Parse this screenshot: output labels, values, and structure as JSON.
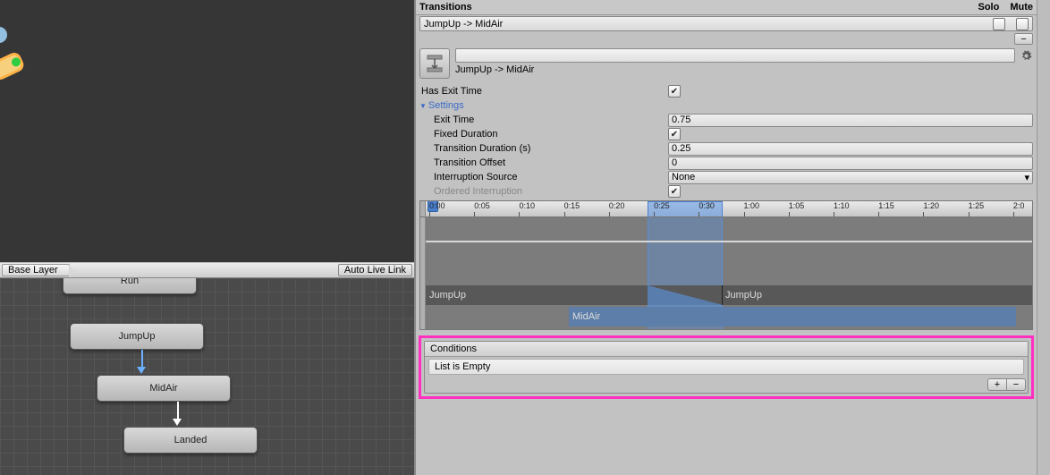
{
  "left": {
    "breadcrumb": "Base Layer",
    "autoLiveLink": "Auto Live Link",
    "nodes": {
      "run": "Run",
      "jumpUp": "JumpUp",
      "midAir": "MidAir",
      "landed": "Landed"
    }
  },
  "inspector": {
    "header": {
      "title": "Transitions",
      "soloLabel": "Solo",
      "muteLabel": "Mute",
      "item": "JumpUp -> MidAir",
      "minus": "−"
    },
    "name": "JumpUp -> MidAir",
    "props": {
      "hasExitTime": {
        "label": "Has Exit Time",
        "checked": true
      },
      "settings": "Settings",
      "exitTime": {
        "label": "Exit Time",
        "value": "0.75"
      },
      "fixedDuration": {
        "label": "Fixed Duration",
        "checked": true
      },
      "transitionDuration": {
        "label": "Transition Duration (s)",
        "value": "0.25"
      },
      "transitionOffset": {
        "label": "Transition Offset",
        "value": "0"
      },
      "interruptionSource": {
        "label": "Interruption Source",
        "value": "None"
      },
      "orderedInterruption": {
        "label": "Ordered Interruption",
        "checked": true
      }
    },
    "timeline": {
      "ticks": [
        "0:00",
        "0:05",
        "0:10",
        "0:15",
        "0:20",
        "0:25",
        "0:30",
        "1:00",
        "1:05",
        "1:10",
        "1:15",
        "1:20",
        "1:25",
        "2:0"
      ],
      "clipA": "JumpUp",
      "clipA2": "JumpUp",
      "clipB": "MidAir"
    },
    "conditions": {
      "title": "Conditions",
      "empty": "List is Empty",
      "plus": "+",
      "minus": "−"
    }
  }
}
